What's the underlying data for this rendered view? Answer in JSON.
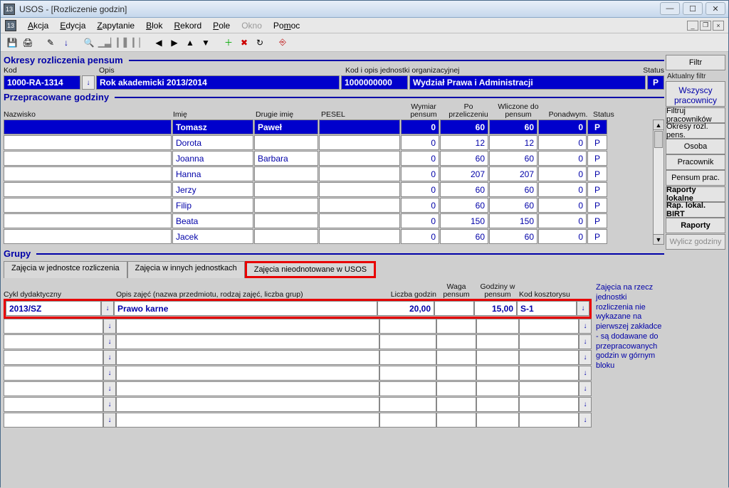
{
  "window": {
    "title": "USOS - [Rozliczenie godzin]"
  },
  "menu": {
    "akcja": "Akcja",
    "edycja": "Edycja",
    "zapytanie": "Zapytanie",
    "blok": "Blok",
    "rekord": "Rekord",
    "pole": "Pole",
    "okno": "Okno",
    "pomoc": "Pomoc"
  },
  "section1": {
    "title": "Okresy rozliczenia pensum",
    "labels": {
      "kod": "Kod",
      "opis": "Opis",
      "kodjedn": "Kod i opis jednostki organizacyjnej",
      "status": "Status"
    },
    "kod": "1000-RA-1314",
    "opis": "Rok akademicki 2013/2014",
    "kodj": "1000000000",
    "jedn": "Wydział Prawa i Administracji",
    "status": "P"
  },
  "section2": {
    "title": "Przepracowane godziny",
    "cols": {
      "nazwisko": "Nazwisko",
      "imie": "Imię",
      "drugie": "Drugie imię",
      "pesel": "PESEL",
      "wymiar": "Wymiar pensum",
      "po": "Po przeliczeniu",
      "wlicz": "Wliczone do pensum",
      "ponad": "Ponadwym.",
      "status": "Status"
    },
    "rows": [
      {
        "imie": "Tomasz",
        "drugie": "Paweł",
        "wymiar": "0",
        "po": "60",
        "wlicz": "60",
        "ponad": "0",
        "status": "P",
        "sel": true
      },
      {
        "imie": "Dorota",
        "drugie": "",
        "wymiar": "0",
        "po": "12",
        "wlicz": "12",
        "ponad": "0",
        "status": "P"
      },
      {
        "imie": "Joanna",
        "drugie": "Barbara",
        "wymiar": "0",
        "po": "60",
        "wlicz": "60",
        "ponad": "0",
        "status": "P"
      },
      {
        "imie": "Hanna",
        "drugie": "",
        "wymiar": "0",
        "po": "207",
        "wlicz": "207",
        "ponad": "0",
        "status": "P"
      },
      {
        "imie": "Jerzy",
        "drugie": "",
        "wymiar": "0",
        "po": "60",
        "wlicz": "60",
        "ponad": "0",
        "status": "P"
      },
      {
        "imie": "Filip",
        "drugie": "",
        "wymiar": "0",
        "po": "60",
        "wlicz": "60",
        "ponad": "0",
        "status": "P"
      },
      {
        "imie": "Beata",
        "drugie": "",
        "wymiar": "0",
        "po": "150",
        "wlicz": "150",
        "ponad": "0",
        "status": "P"
      },
      {
        "imie": "Jacek",
        "drugie": "",
        "wymiar": "0",
        "po": "60",
        "wlicz": "60",
        "ponad": "0",
        "status": "P"
      }
    ]
  },
  "section3": {
    "title": "Grupy",
    "tabs": {
      "t1": "Zajęcia w jednostce rozliczenia",
      "t2": "Zajęcia w innych jednostkach",
      "t3": "Zajęcia nieodnotowane w USOS"
    },
    "cols": {
      "cykl": "Cykl dydaktyczny",
      "opis": "Opis zajęć (nazwa przedmiotu, rodzaj zajęć, liczba grup)",
      "liczba": "Liczba godzin",
      "waga": "Waga pensum",
      "godz": "Godziny w pensum",
      "kod": "Kod kosztorysu"
    },
    "row": {
      "cykl": "2013/SZ",
      "opis": "Prawo karne",
      "liczba": "20,00",
      "waga": "",
      "godz": "15,00",
      "kod": "S-1"
    },
    "note": "Zajęcia na rzecz jednostki rozliczenia nie wykazane na pierwszej zakładce - są dodawane do przepracowanych godzin w górnym bloku"
  },
  "sidebar": {
    "filtr": "Filtr",
    "aktual": "Aktualny filtr",
    "wszyscy": "Wszyscy pracownicy",
    "buttons": [
      "Filtruj pracowników",
      "Okresy rozl. pens.",
      "Osoba",
      "Pracownik",
      "Pensum prac."
    ],
    "bold_buttons": [
      "Raporty lokalne",
      "Rap. lokal. BIRT",
      "Raporty"
    ],
    "wylicz": "Wylicz godziny"
  }
}
